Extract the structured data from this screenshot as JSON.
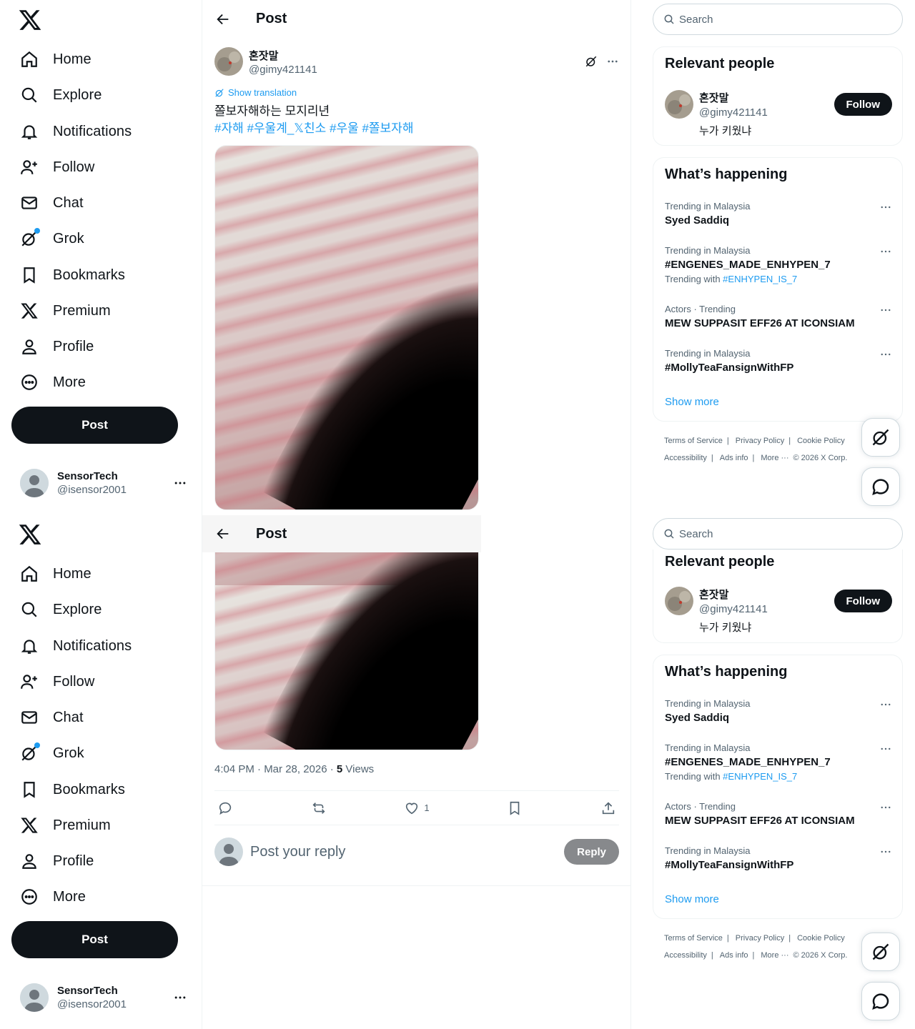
{
  "nav": {
    "items": [
      {
        "label": "Home",
        "icon": "home-icon"
      },
      {
        "label": "Explore",
        "icon": "search-icon"
      },
      {
        "label": "Notifications",
        "icon": "bell-icon"
      },
      {
        "label": "Follow",
        "icon": "person-add-icon"
      },
      {
        "label": "Chat",
        "icon": "envelope-icon"
      },
      {
        "label": "Grok",
        "icon": "grok-icon"
      },
      {
        "label": "Bookmarks",
        "icon": "bookmark-icon"
      },
      {
        "label": "Premium",
        "icon": "x-logo-icon"
      },
      {
        "label": "Profile",
        "icon": "person-icon"
      },
      {
        "label": "More",
        "icon": "more-circle-icon"
      }
    ],
    "post_label": "Post"
  },
  "account": {
    "name": "SensorTech",
    "handle": "@isensor2001"
  },
  "header": {
    "title": "Post"
  },
  "tweet": {
    "author_name": "혼잣말",
    "author_handle": "@gimy421141",
    "show_translation": "Show translation",
    "text": "쫄보자해하는 모지리년",
    "hashtags": "#자해 #우울계_𝕏친소 #우울 #쫄보자해",
    "time": "4:04 PM · Mar 28, 2026 · ",
    "views_count": "5",
    "views_label": " Views",
    "likes": "1"
  },
  "reply": {
    "placeholder": "Post your reply",
    "button": "Reply"
  },
  "search": {
    "placeholder": "Search"
  },
  "relevant": {
    "title": "Relevant people",
    "person": {
      "name": "혼잣말",
      "handle": "@gimy421141",
      "bio": "누가 키웠냐",
      "follow": "Follow"
    }
  },
  "happening": {
    "title": "What’s happening",
    "trends": [
      {
        "context": "Trending in Malaysia",
        "title": "Syed Saddiq",
        "with": ""
      },
      {
        "context": "Trending in Malaysia",
        "title": "#ENGENES_MADE_ENHYPEN_7",
        "with_label": "Trending with ",
        "with": "#ENHYPEN_IS_7"
      },
      {
        "context": "Actors · Trending",
        "title": "MEW SUPPASIT EFF26 AT ICONSIAM",
        "with": ""
      },
      {
        "context": "Trending in Malaysia",
        "title": "#MollyTeaFansignWithFP",
        "with": ""
      }
    ],
    "show_more": "Show more"
  },
  "footer": {
    "terms": "Terms of Service",
    "privacy": "Privacy Policy",
    "cookie": "Cookie Policy",
    "accessibility": "Accessibility",
    "ads": "Ads info",
    "more": "More ···",
    "copyright": "© 2026 X Corp."
  },
  "colors": {
    "accent": "#1d9bf0",
    "text": "#0f1419",
    "muted": "#536471"
  }
}
